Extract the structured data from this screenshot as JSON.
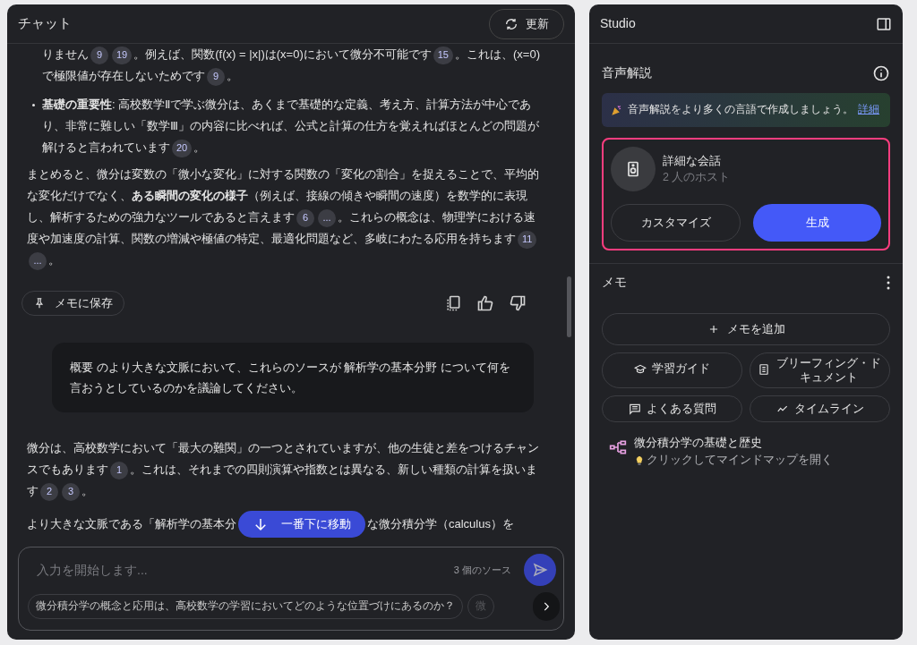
{
  "chat": {
    "title": "チャット",
    "refresh_button": "更新",
    "messages": [
      {
        "kind": "answer",
        "blocks": [
          {
            "kind": "indent",
            "segments": [
              {
                "kind": "text",
                "text": "りません"
              },
              {
                "kind": "cite",
                "text": "9"
              },
              {
                "kind": "cite",
                "text": "19"
              },
              {
                "kind": "text",
                "text": "。例えば、関数(f(x) = |x|)は(x=0)において微分不可能です"
              },
              {
                "kind": "cite",
                "text": "15"
              },
              {
                "kind": "text",
                "text": "。これは、(x=0)で極限値が存在しないためです"
              },
              {
                "kind": "cite",
                "text": "9"
              },
              {
                "kind": "text",
                "text": "。"
              }
            ]
          },
          {
            "kind": "bullet",
            "segments": [
              {
                "kind": "bold",
                "text": "基礎の重要性"
              },
              {
                "kind": "text",
                "text": ": 高校数学Ⅱで学ぶ微分は、あくまで基礎的な定義、考え方、計算方法が中心であり、非常に難しい「数学Ⅲ」の内容に比べれば、公式と計算の仕方を覚えればほとんどの問題が解けると言われています"
              },
              {
                "kind": "cite",
                "text": "20"
              },
              {
                "kind": "text",
                "text": "。"
              }
            ]
          },
          {
            "kind": "para",
            "segments": [
              {
                "kind": "text",
                "text": "まとめると、微分は変数の「微小な変化」に対する関数の「変化の割合」を捉えることで、平均的な変化だけでなく、"
              },
              {
                "kind": "bold",
                "text": "ある瞬間の変化の様子"
              },
              {
                "kind": "text",
                "text": "（例えば、接線の傾きや瞬間の速度）を数学的に表現し、解析するための強力なツールであると言えます"
              },
              {
                "kind": "cite",
                "text": "6"
              },
              {
                "kind": "cite",
                "text": "..."
              },
              {
                "kind": "text",
                "text": "。これらの概念は、物理学における速度や加速度の計算、関数の増減や極値の特定、最適化問題など、多岐にわたる応用を持ちます"
              },
              {
                "kind": "cite",
                "text": "11"
              },
              {
                "kind": "cite",
                "text": "..."
              },
              {
                "kind": "text",
                "text": "。"
              }
            ]
          }
        ],
        "save_button": "メモに保存"
      },
      {
        "kind": "question",
        "text": "概要 のより大きな文脈において、これらのソースが 解析学の基本分野 について何を言おうとしているのかを議論してください。"
      },
      {
        "kind": "answer",
        "blocks": [
          {
            "kind": "para",
            "segments": [
              {
                "kind": "text",
                "text": "微分は、高校数学において「最大の難関」の一つとされていますが、他の生徒と差をつけるチャンスでもあります"
              },
              {
                "kind": "cite",
                "text": "1"
              },
              {
                "kind": "text",
                "text": "。これは、それまでの四則演算や指数とは異なる、新しい種類の計算を扱います"
              },
              {
                "kind": "cite",
                "text": "2"
              },
              {
                "kind": "cite",
                "text": "3"
              },
              {
                "kind": "text",
                "text": "。"
              }
            ]
          }
        ]
      }
    ],
    "partial_line": {
      "left": "より大きな文脈である「解析学の基本分",
      "right": "な微分積分学（calculus）を"
    },
    "jump_button": "一番下に移動",
    "input": {
      "placeholder": "入力を開始します...",
      "source_count": "3 個のソース"
    },
    "suggestions": [
      "微分積分学の概念と応用は、高校数学の学習においてどのような位置づけにあるのか？",
      "微"
    ]
  },
  "studio": {
    "title": "Studio",
    "audio": {
      "title": "音声解説",
      "banner": "音声解説をより多くの言語で作成しましょう。",
      "banner_link": "詳細",
      "card_title": "詳細な会話",
      "card_subtitle": "2 人のホスト",
      "customize_button": "カスタマイズ",
      "generate_button": "生成",
      "highlighted": true
    },
    "notes": {
      "title": "メモ",
      "add_button": "メモを追加",
      "tools": [
        {
          "kind": "guide",
          "label": "学習ガイド"
        },
        {
          "kind": "doc",
          "label": "ブリーフィング・ドキュメント"
        },
        {
          "kind": "faq",
          "label": "よくある質問"
        },
        {
          "kind": "timeline",
          "label": "タイムライン"
        }
      ],
      "items": [
        {
          "title": "微分積分学の基礎と歴史",
          "hint": "クリックしてマインドマップを開く"
        }
      ]
    }
  }
}
